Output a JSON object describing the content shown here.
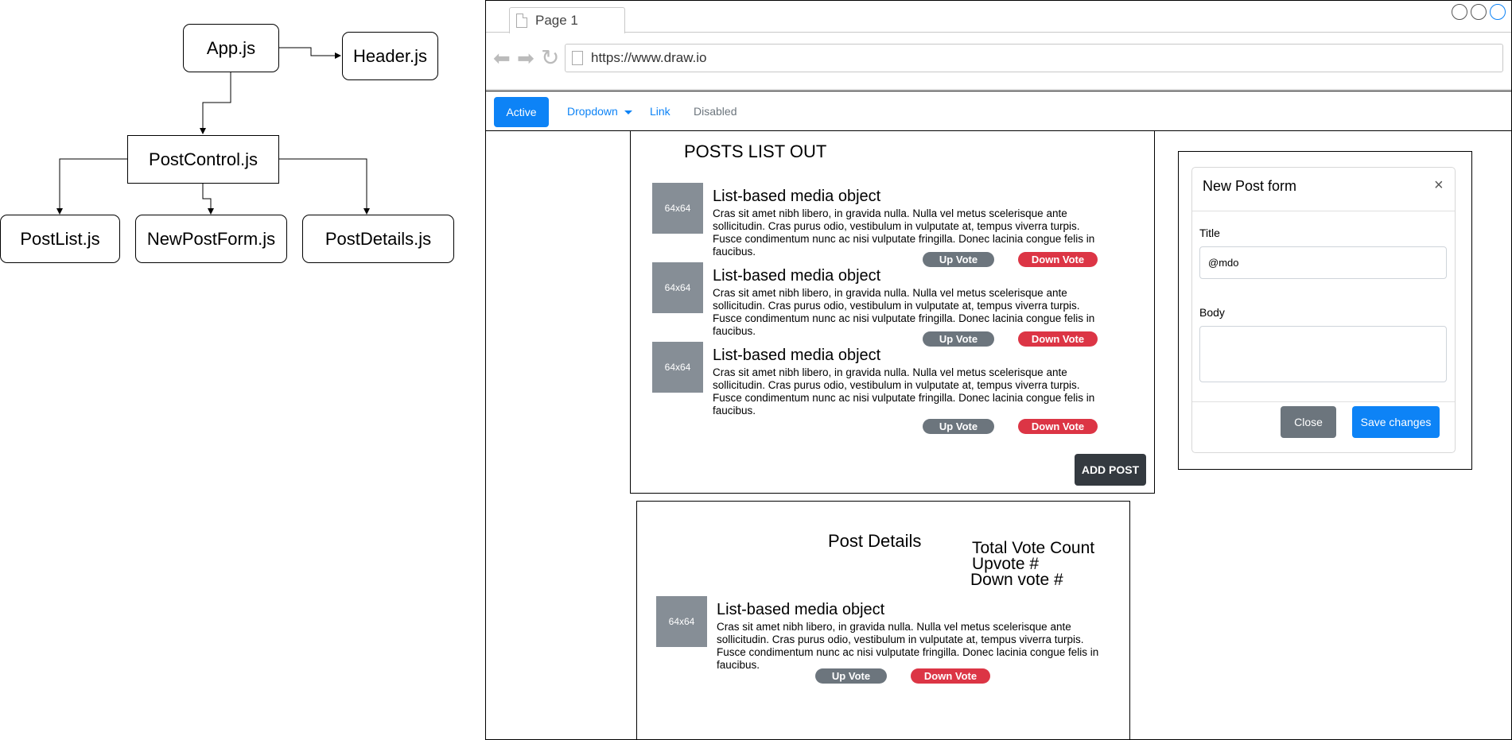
{
  "diagram": {
    "nodes": {
      "app": "App.js",
      "header": "Header.js",
      "postcontrol": "PostControl.js",
      "postlist": "PostList.js",
      "newpostform": "NewPostForm.js",
      "postdetails": "PostDetails.js"
    }
  },
  "browser": {
    "tab_label": "Page 1",
    "url": "https://www.draw.io"
  },
  "navbar": {
    "active": "Active",
    "dropdown": "Dropdown",
    "link": "Link",
    "disabled": "Disabled"
  },
  "posts_list": {
    "heading": "POSTS LIST OUT",
    "items": [
      {
        "thumb": "64x64",
        "title": "List-based media object",
        "body": "Cras sit amet nibh libero, in gravida nulla. Nulla vel metus scelerisque ante sollicitudin. Cras purus odio, vestibulum in vulputate at, tempus viverra turpis. Fusce condimentum nunc ac nisi vulputate fringilla. Donec lacinia congue felis in faucibus.",
        "up": "Up Vote",
        "down": "Down Vote"
      },
      {
        "thumb": "64x64",
        "title": "List-based media object",
        "body": "Cras sit amet nibh libero, in gravida nulla. Nulla vel metus scelerisque ante sollicitudin. Cras purus odio, vestibulum in vulputate at, tempus viverra turpis. Fusce condimentum nunc ac nisi vulputate fringilla. Donec lacinia congue felis in faucibus.",
        "up": "Up Vote",
        "down": "Down Vote"
      },
      {
        "thumb": "64x64",
        "title": "List-based media object",
        "body": "Cras sit amet nibh libero, in gravida nulla. Nulla vel metus scelerisque ante sollicitudin. Cras purus odio, vestibulum in vulputate at, tempus viverra turpis. Fusce condimentum nunc ac nisi vulputate fringilla. Donec lacinia congue felis in faucibus.",
        "up": "Up Vote",
        "down": "Down Vote"
      }
    ],
    "add_post": "ADD POST"
  },
  "modal": {
    "title": "New Post form",
    "close_glyph": "×",
    "title_label": "Title",
    "title_value": "@mdo",
    "body_label": "Body",
    "body_value": "",
    "close_button": "Close",
    "save_button": "Save changes"
  },
  "post_details": {
    "heading": "Post Details",
    "total_vote": "Total Vote Count",
    "upvote": "Upvote #",
    "downvote": "Down vote #",
    "thumb": "64x64",
    "title": "List-based media object",
    "body": "Cras sit amet nibh libero, in gravida nulla. Nulla vel metus scelerisque ante sollicitudin. Cras purus odio, vestibulum in vulputate at, tempus viverra turpis. Fusce condimentum nunc ac nisi vulputate fringilla. Donec lacinia congue felis in faucibus.",
    "up": "Up Vote",
    "down": "Down Vote"
  },
  "colors": {
    "primary": "#0d83f6",
    "secondary": "#6c757d",
    "danger": "#dc3545",
    "dark": "#343a40",
    "placeholder": "#868e96"
  }
}
